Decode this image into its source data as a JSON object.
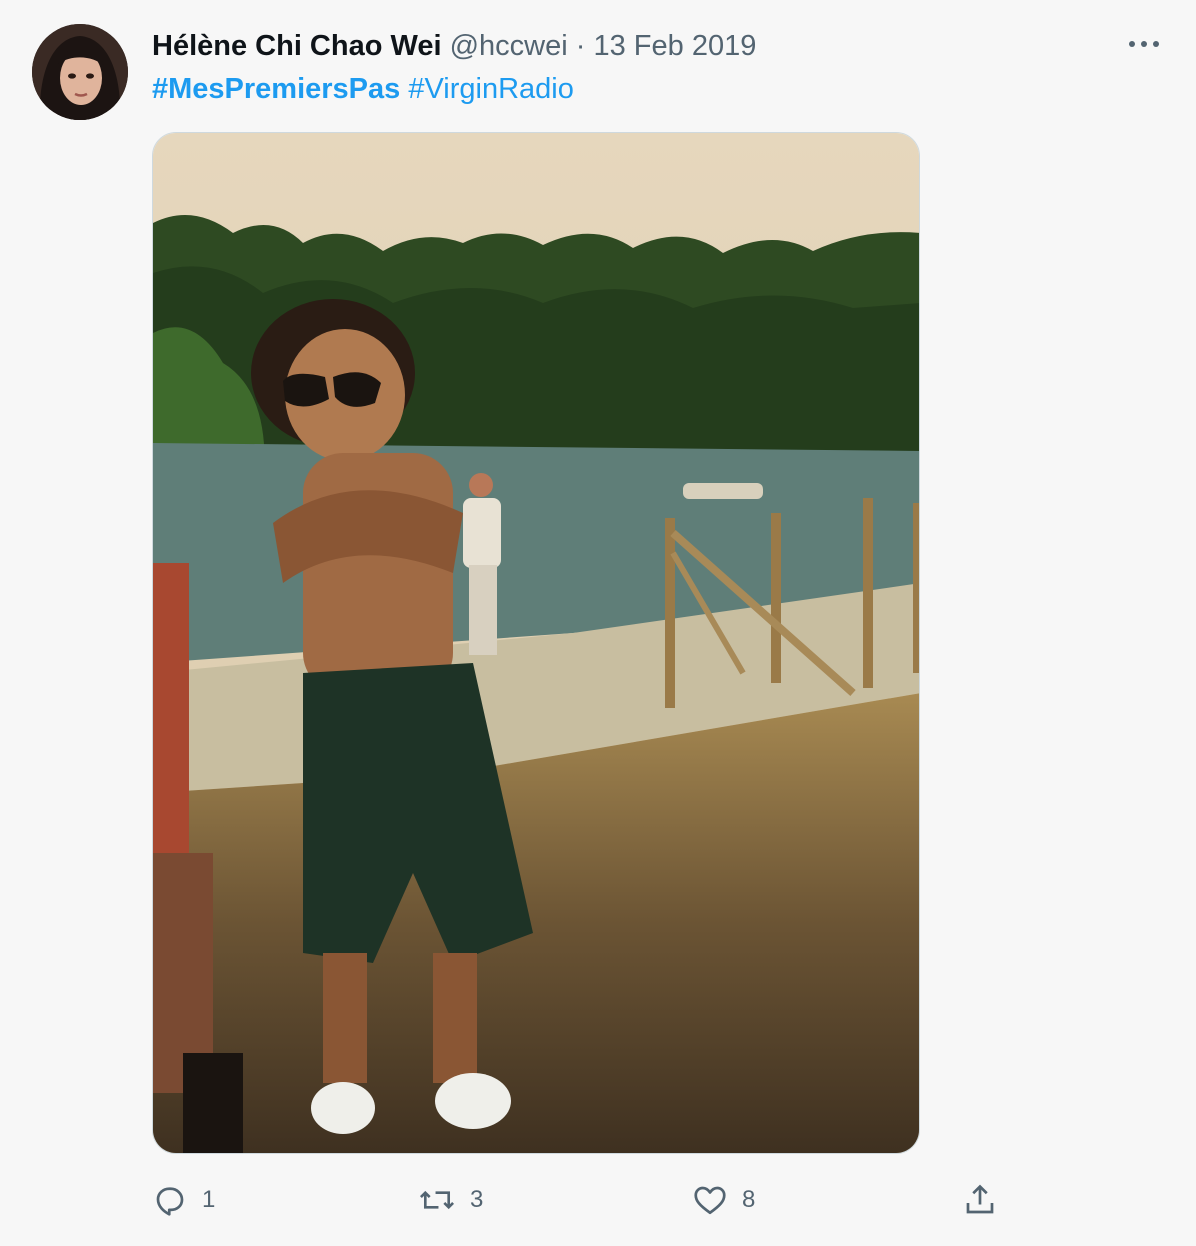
{
  "tweet": {
    "author_name": "Hélène Chi Chao Wei",
    "handle": "@hccwei",
    "separator": "·",
    "date": "13 Feb 2019",
    "hashtags": [
      "#MesPremiersPas",
      "#VirginRadio"
    ],
    "more_icon": "more-horizontal-icon",
    "media_description_icon": "photo"
  },
  "actions": {
    "reply": {
      "icon": "reply-icon",
      "count": "1"
    },
    "retweet": {
      "icon": "retweet-icon",
      "count": "3"
    },
    "like": {
      "icon": "heart-icon",
      "count": "8"
    },
    "share": {
      "icon": "share-icon"
    }
  },
  "colors": {
    "accent": "#1d9bf0",
    "text": "#0f1419",
    "secondary": "#536471",
    "background": "#f7f7f7"
  }
}
